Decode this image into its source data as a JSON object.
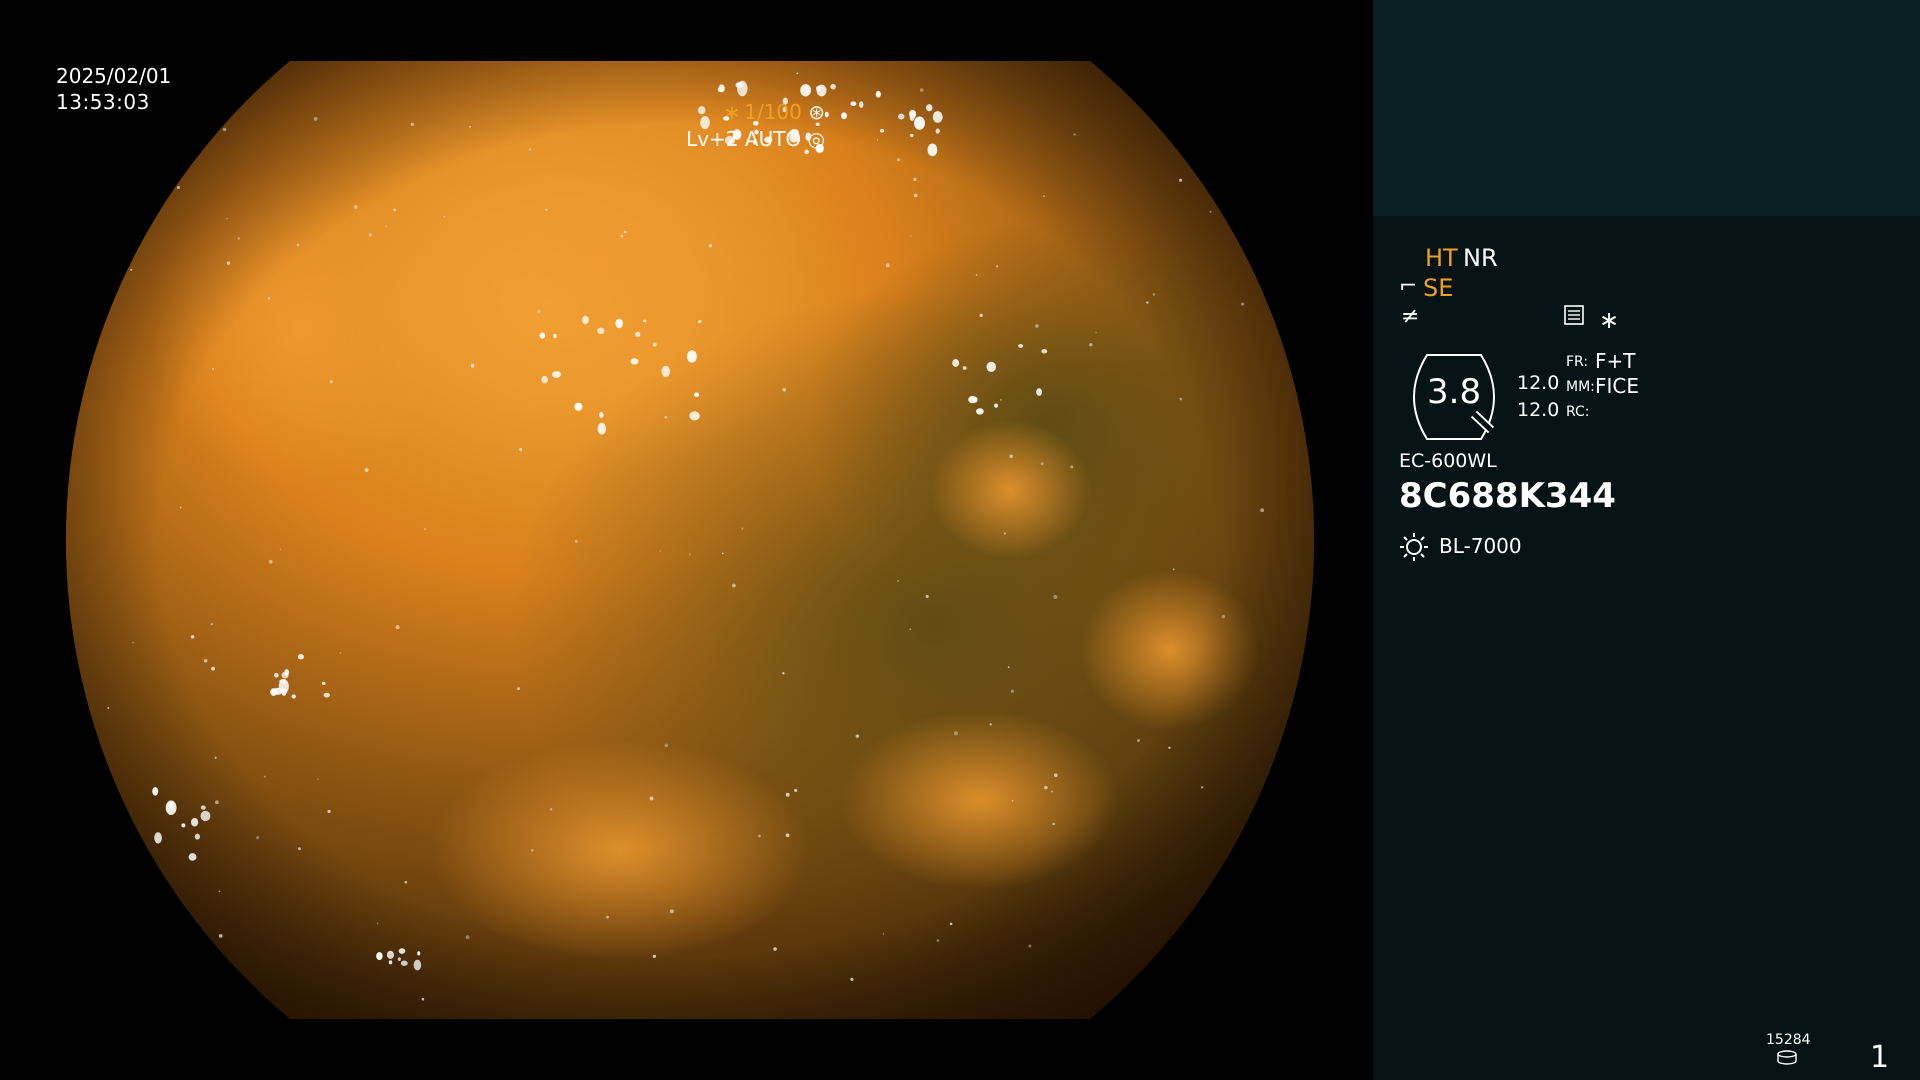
{
  "osd": {
    "date": "2025/02/01",
    "time": "13:53:03",
    "shutter": "∗ 1/100",
    "shutter_icon": "⊛",
    "iris_mode": "Lv+2 AUTO",
    "iris_icon": "◎"
  },
  "panel": {
    "ht": "HT",
    "nr": "NR",
    "se_icon": "⌐",
    "se": "SE",
    "sharp_icon": "≠",
    "menu_icon": "menu-list-icon",
    "star_icon": "∗",
    "zoom_value": "3.8",
    "num1": "12.0",
    "num2": "12.0",
    "fr_label": "FR:",
    "fr_value": "F+T",
    "mm_label": "MM:",
    "mm_value": "FICE",
    "rc_label": "RC:",
    "scope_model": "EC-600WL",
    "serial": "8C688K344",
    "light_source": "BL-7000",
    "image_counter": "15284",
    "page_number": "1"
  },
  "colors": {
    "panel_bg": "#061314",
    "panel_top_bg": "#0a2023",
    "highlight_orange": "#f0a020"
  }
}
